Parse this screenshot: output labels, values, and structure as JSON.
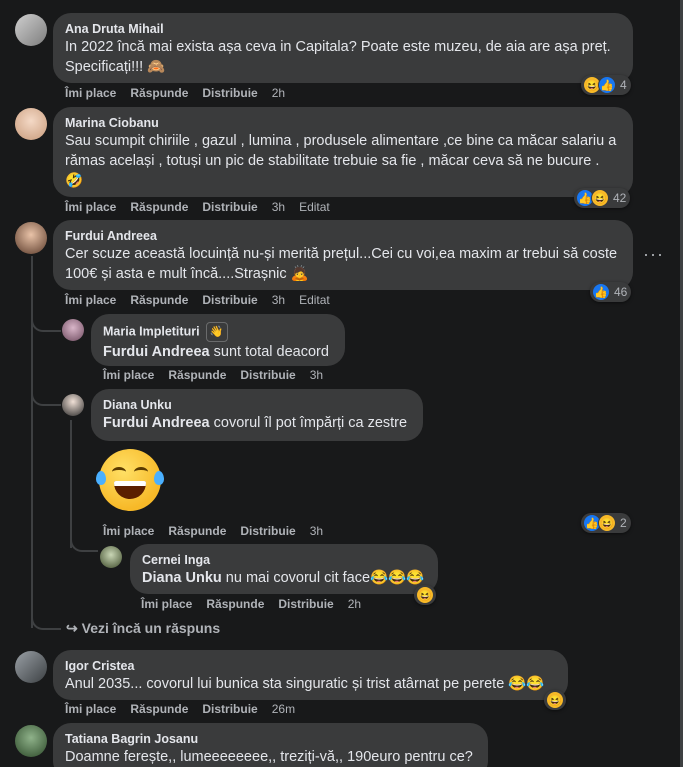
{
  "comments": [
    {
      "author": "Ana Druta Mihail",
      "text": "In 2022 încă mai exista așa ceva in Capitala? Poate este muzeu, de aia are așa preț. Specificați!!! 🙈",
      "like": "Îmi place",
      "reply": "Răspunde",
      "share": "Distribuie",
      "time": "2h",
      "reactions": [
        "haha",
        "like"
      ],
      "count": "4"
    },
    {
      "author": "Marina Ciobanu",
      "text": "Sau scumpit chiriile , gazul , lumina , produsele alimentare ,ce bine ca măcar salariu a rămas același , totuși un pic de stabilitate trebuie sa fie , măcar ceva să ne bucure . 🤣",
      "like": "Îmi place",
      "reply": "Răspunde",
      "share": "Distribuie",
      "time": "3h",
      "edited": "Editat",
      "reactions": [
        "like",
        "haha"
      ],
      "count": "42"
    },
    {
      "author": "Furdui Andreea",
      "text": "Cer scuze această locuință nu-și merită prețul...Cei cu voi,ea maxim ar trebui să coste 100€ și asta e mult încă....Strașnic 🙇",
      "like": "Îmi place",
      "reply": "Răspunde",
      "share": "Distribuie",
      "time": "3h",
      "edited": "Editat",
      "reactions": [
        "like"
      ],
      "count": "46",
      "more": "···",
      "replies": [
        {
          "author": "Maria Impletituri",
          "badge": "👋",
          "mention": "Furdui Andreea",
          "text": " sunt total deacord",
          "like": "Îmi place",
          "reply": "Răspunde",
          "share": "Distribuie",
          "time": "3h"
        },
        {
          "author": "Diana Unku",
          "mention": "Furdui Andreea",
          "text": " covorul îl pot împărți ca zestre",
          "like": "Îmi place",
          "reply": "Răspunde",
          "share": "Distribuie",
          "time": "3h",
          "reactions": [
            "like",
            "haha"
          ],
          "count": "2",
          "sub": {
            "author": "Cernei Inga",
            "mention": "Diana Unku",
            "text": " nu mai covorul cit face😂😂😂",
            "like": "Îmi place",
            "reply": "Răspunde",
            "share": "Distribuie",
            "time": "2h",
            "reactions": [
              "haha"
            ]
          }
        }
      ],
      "see_more": "Vezi încă un răspuns"
    },
    {
      "author": "Igor Cristea",
      "text": "Anul 2035... covorul lui bunica sta singuratic și trist atârnat pe perete 😂😂",
      "like": "Îmi place",
      "reply": "Răspunde",
      "share": "Distribuie",
      "time": "26m",
      "reactions": [
        "haha"
      ]
    },
    {
      "author": "Tatiana Bagrin Josanu",
      "text": "Doamne ferește,, lumeeeeeeee,, treziți-vă,, 190euro pentru ce?"
    }
  ],
  "colors": {
    "background": "#18191a",
    "bubble": "#3a3b3c",
    "text": "#e4e6eb",
    "secondary": "#b0b3b8",
    "like_blue": "#1877f2",
    "haha_yellow": "#f7b928"
  },
  "icons": {
    "haha": "haha-reaction-icon",
    "like": "like-reaction-icon",
    "reply_arrow": "reply-arrow-icon",
    "big_emoji": "laughing-tears-emoji"
  }
}
